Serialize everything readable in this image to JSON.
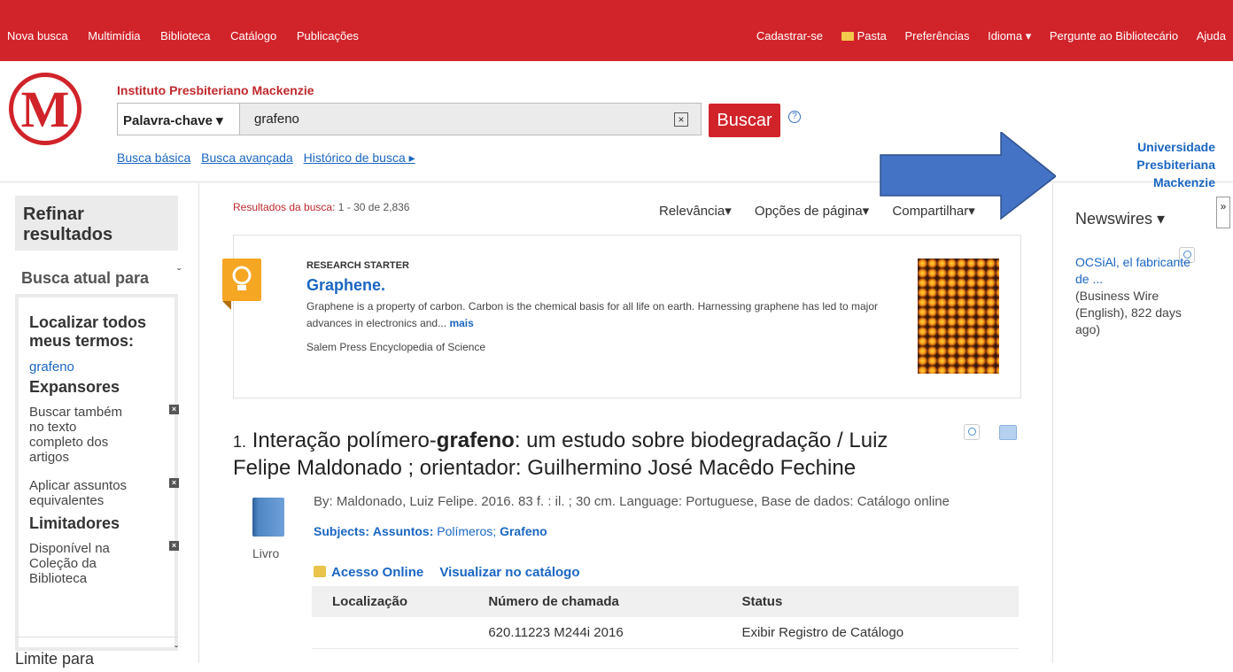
{
  "topnav": {
    "left": [
      "Nova busca",
      "Multimídia",
      "Biblioteca",
      "Catálogo",
      "Publicações"
    ],
    "right": [
      "Cadastrar-se",
      "Pasta",
      "Preferências",
      "Idioma ▾",
      "Pergunte ao Bibliotecário",
      "Ajuda"
    ]
  },
  "header": {
    "logo_letter": "M",
    "institution": "Instituto Presbiteriano Mackenzie",
    "field_select": "Palavra-chave ▾",
    "search_value": "grafeno",
    "clear_icon": "×",
    "search_button": "Buscar",
    "help_icon": "?",
    "links": [
      "Busca básica",
      "Busca avançada",
      "Histórico de busca ▸"
    ],
    "university_lines": [
      "Universidade",
      "Presbiteriana",
      "Mackenzie"
    ],
    "arrow_color": "#4472c4"
  },
  "sidebar": {
    "refine_title": "Refinar resultados",
    "current_search": "Busca atual para",
    "chevron": "ˇ",
    "find_all_heading": "Localizar todos meus termos:",
    "term": "grafeno",
    "expanders_heading": "Expansores",
    "expanders": [
      "Buscar também no texto completo dos artigos",
      "Aplicar assuntos equivalentes"
    ],
    "limiters_heading": "Limitadores",
    "limiters": [
      "Disponível na Coleção da Biblioteca"
    ],
    "remove_icon": "×",
    "limit_section": "Limite para"
  },
  "results": {
    "count_label": "Resultados da busca:",
    "count_value": "1 - 30 de 2,836",
    "sort": [
      "Relevância▾",
      "Opções de página▾",
      "Compartilhar▾"
    ],
    "research_starter": {
      "label": "RESEARCH STARTER",
      "title": "Graphene.",
      "text": "Graphene is a property of carbon. Carbon is the chemical basis for all life on earth. Harnessing graphene has led to major advances in electronics and...",
      "more": "mais",
      "source": "Salem Press Encyclopedia of Science"
    },
    "item1": {
      "number": "1.",
      "title_pre": "Interação polímero-",
      "title_bold": "grafeno",
      "title_post": ": um estudo sobre biodegradação / Luiz Felipe Maldonado ; orientador: Guilhermino José Macêdo Fechine",
      "type": "Livro",
      "meta": "By: Maldonado, Luiz Felipe. 2016. 83 f. : il. ; 30 cm. Language: Portuguese, Base de dados: Catálogo online",
      "subjects_label": "Subjects:",
      "subjects_sub": "Assuntos:",
      "subjects": "Polímeros;",
      "subjects_bold": "Grafeno",
      "links": [
        "Acesso Online",
        "Visualizar no catálogo"
      ],
      "holdings_headers": [
        "Localização",
        "Número de chamada",
        "Status"
      ],
      "holdings_row": [
        "",
        "620.11223 M244i 2016",
        "Exibir Registro de Catálogo"
      ]
    }
  },
  "right_panel": {
    "collapse": "»",
    "newswires_title": "Newswires ▾",
    "item_link": "OCSiAl, el fabricante de ...",
    "item_meta": "(Business Wire (English), 822 days ago)"
  }
}
